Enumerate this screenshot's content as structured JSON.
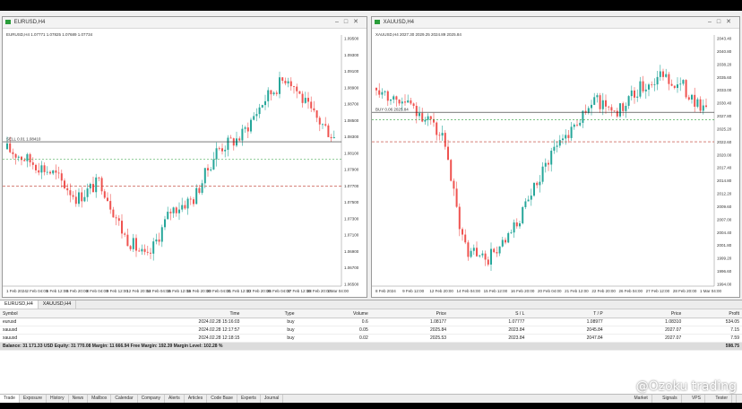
{
  "windows": [
    {
      "title": "EURUSD,H4",
      "info": "EURUSD,H4  1.07771 1.07825 1.07689 1.07734",
      "price_label": "SELL 0.01 1.08410",
      "price_axis": [
        "1.09500",
        "1.09300",
        "1.09100",
        "1.08900",
        "1.08700",
        "1.08500",
        "1.08300",
        "1.08100",
        "1.07900",
        "1.07700",
        "1.07500",
        "1.07300",
        "1.07100",
        "1.06900",
        "1.06700",
        "1.06500"
      ],
      "time_axis": [
        "1 Feb 2024",
        "2 Feb 04:00",
        "5 Feb 12:00",
        "6 Feb 20:00",
        "8 Feb 04:00",
        "9 Feb 12:00",
        "12 Feb 20:00",
        "14 Feb 04:00",
        "15 Feb 12:00",
        "16 Feb 20:00",
        "20 Feb 04:00",
        "21 Feb 12:00",
        "22 Feb 20:00",
        "26 Feb 04:00",
        "27 Feb 12:00",
        "28 Feb 20:00",
        "1 Mar 04:00"
      ]
    },
    {
      "title": "XAUUSD,H4",
      "info": "XAUUSD,H4  2027.30 2029.25 2024.89 2025.84",
      "price_label": "BUY 0.06 2025.84",
      "price_axis": [
        "2043.40",
        "2040.80",
        "2038.20",
        "2035.60",
        "2033.00",
        "2030.40",
        "2027.80",
        "2025.20",
        "2022.60",
        "2020.00",
        "2017.40",
        "2014.80",
        "2012.20",
        "2009.60",
        "2007.00",
        "2004.40",
        "2001.80",
        "1999.20",
        "1996.60",
        "1994.00"
      ],
      "time_axis": [
        "8 Feb 2024",
        "9 Feb 12:00",
        "12 Feb 20:00",
        "14 Feb 04:00",
        "15 Feb 12:00",
        "16 Feb 20:00",
        "20 Feb 04:00",
        "21 Feb 12:00",
        "22 Feb 20:00",
        "26 Feb 04:00",
        "27 Feb 12:00",
        "28 Feb 20:00",
        "1 Mar 04:00"
      ]
    }
  ],
  "symbol_tabs": [
    "EURUSD,H4",
    "XAUUSD,H4"
  ],
  "table": {
    "columns": [
      "Symbol",
      "Time",
      "Type",
      "Volume",
      "Price",
      "S / L",
      "T / P",
      "Price",
      "Profit"
    ],
    "rows": [
      [
        "eurusd",
        "2024.02.28 15:16:03",
        "buy",
        "0.6",
        "1.08177",
        "1.07777",
        "1.08977",
        "1.08310",
        "534.05"
      ],
      [
        "xauusd",
        "2024.02.28 12:17:57",
        "buy",
        "0.05",
        "2025.84",
        "2023.84",
        "2045.84",
        "2027.07",
        "7.15"
      ],
      [
        "xauusd",
        "2024.02.28 12:18:15",
        "buy",
        "0.02",
        "2025.53",
        "2023.84",
        "2047.84",
        "2027.07",
        "7.59"
      ]
    ],
    "balance": "Balance: 31 171.33 USD  Equity: 31 770.08  Margin: 11 666.94  Free Margin: 192.39  Margin Level: 102.28 %",
    "balance_profit": "598.75"
  },
  "bottom_tabs": [
    "Trade",
    "Exposure",
    "History",
    "News",
    "Mailbox",
    "Calendar",
    "Company",
    "Alerts",
    "Articles",
    "Code Base",
    "Experts",
    "Journal"
  ],
  "status": {
    "market": "Market",
    "signals": "Signals",
    "vps": "VPS",
    "tester": "Tester"
  },
  "watermark": "@Ozoku trading",
  "colors": {
    "bull": "#26a69a",
    "bear": "#ef5350",
    "price_line": "#2a2a2a",
    "sl_line": "#c0392b",
    "tp_line": "#2a9d3a"
  }
}
